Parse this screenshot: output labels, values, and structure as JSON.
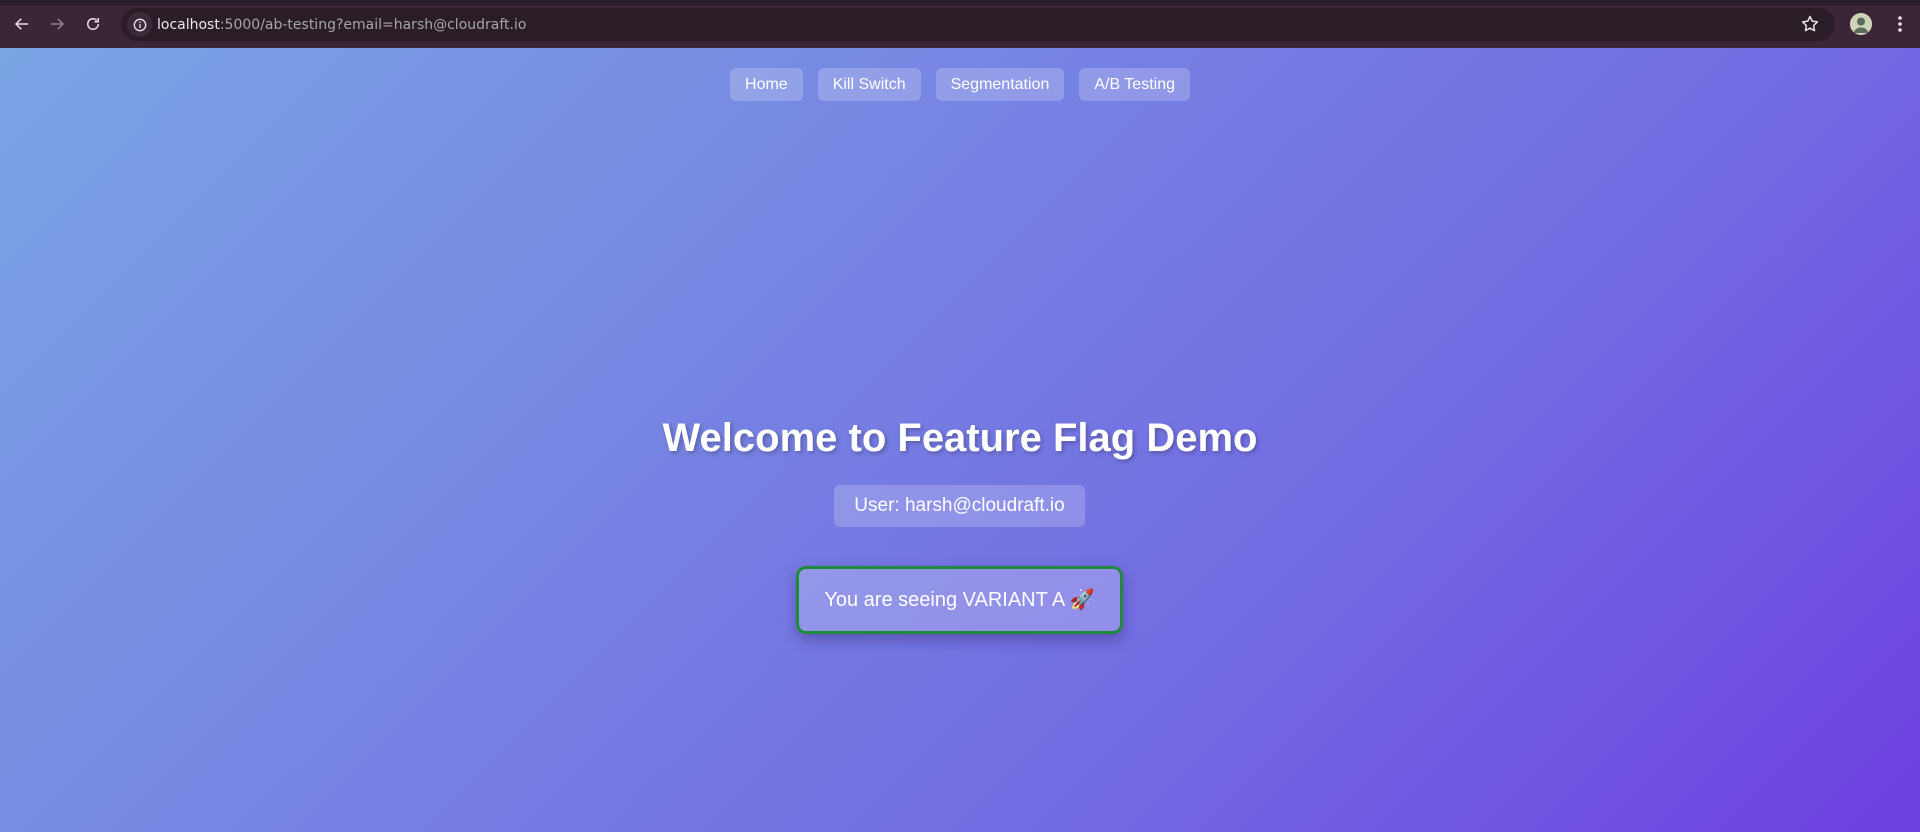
{
  "browser": {
    "url_host": "localhost",
    "url_rest": ":5000/ab-testing?email=harsh@cloudraft.io",
    "back_icon": "arrow-left-icon",
    "forward_icon": "arrow-right-icon",
    "reload_icon": "reload-icon",
    "bookmark_icon": "star-icon",
    "menu_icon": "kebab-menu-icon",
    "chrome_color": "#3a2636"
  },
  "nav": {
    "items": [
      {
        "label": "Home"
      },
      {
        "label": "Kill Switch"
      },
      {
        "label": "Segmentation"
      },
      {
        "label": "A/B Testing"
      }
    ]
  },
  "main": {
    "title": "Welcome to Feature Flag Demo",
    "user_label": "User: harsh@cloudraft.io",
    "variant_message": "You are seeing VARIANT A 🚀",
    "variant_border_color": "#1e8a3a"
  },
  "theme": {
    "gradient_start": "#7aa4e4",
    "gradient_end": "#6d3fe0"
  }
}
